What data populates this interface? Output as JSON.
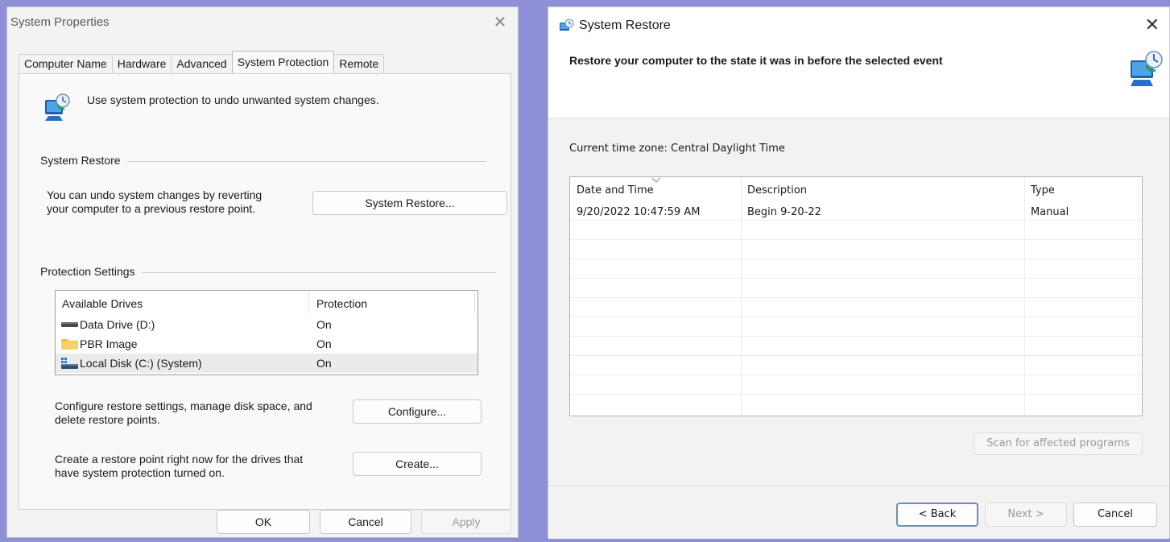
{
  "system_properties": {
    "title": "System Properties",
    "close_glyph": "✕",
    "tabs": [
      {
        "label": "Computer Name",
        "active": false
      },
      {
        "label": "Hardware",
        "active": false
      },
      {
        "label": "Advanced",
        "active": false
      },
      {
        "label": "System Protection",
        "active": true
      },
      {
        "label": "Remote",
        "active": false
      }
    ],
    "header_icon": "system-protection-icon",
    "header_text": "Use system protection to undo unwanted system changes.",
    "restore_group": {
      "label": "System Restore",
      "description_line1": "You can undo system changes by reverting",
      "description_line2": "your computer to a previous restore point.",
      "button_label": "System Restore..."
    },
    "protection_group": {
      "label": "Protection Settings",
      "columns": {
        "drives": "Available Drives",
        "protection": "Protection"
      },
      "drives": [
        {
          "icon": "hard-drive-icon",
          "name": "Data Drive (D:)",
          "protection": "On",
          "selected": false
        },
        {
          "icon": "folder-icon",
          "name": "PBR Image",
          "protection": "On",
          "selected": false
        },
        {
          "icon": "windows-drive-icon",
          "name": "Local Disk (C:) (System)",
          "protection": "On",
          "selected": true
        }
      ],
      "configure_text_line1": "Configure restore settings, manage disk space, and",
      "configure_text_line2": "delete restore points.",
      "configure_button": "Configure...",
      "create_text_line1": "Create a restore point right now for the drives that",
      "create_text_line2": "have system protection turned on.",
      "create_button": "Create..."
    },
    "buttons": {
      "ok": "OK",
      "cancel": "Cancel",
      "apply": "Apply"
    }
  },
  "system_restore": {
    "title": "System Restore",
    "close_glyph": "✕",
    "heading": "Restore your computer to the state it was in before the selected event",
    "timezone_text": "Current time zone: Central Daylight Time",
    "columns": {
      "date": "Date and Time",
      "description": "Description",
      "type": "Type"
    },
    "rows": [
      {
        "date": "9/20/2022 10:47:59 AM",
        "description": "Begin 9-20-22",
        "type": "Manual"
      }
    ],
    "scan_button": "Scan for affected programs",
    "buttons": {
      "back": "< Back",
      "next": "Next >",
      "cancel": "Cancel"
    },
    "colors": {
      "primary_button_border": "#6d8fb5",
      "background": "#8f8fd6"
    }
  }
}
